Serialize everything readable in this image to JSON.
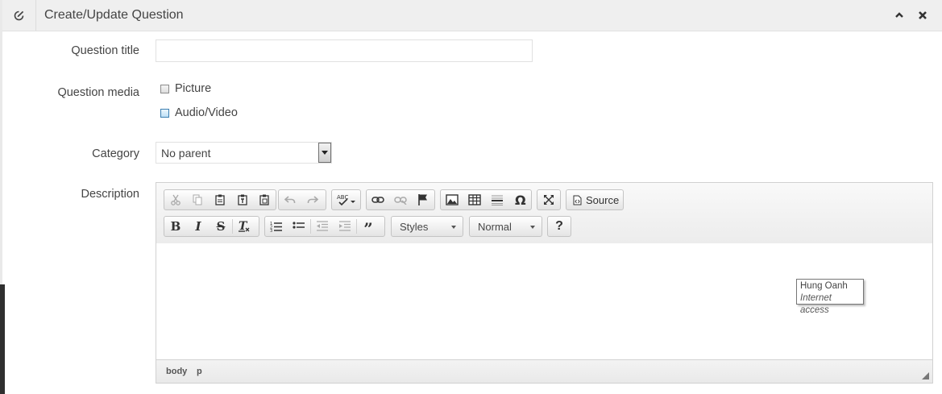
{
  "panel": {
    "title": "Create/Update Question",
    "collapse_icon": "chevron-up-icon",
    "close_icon": "close-icon",
    "edit_icon": "edit-icon"
  },
  "form": {
    "question_title": {
      "label": "Question title",
      "value": ""
    },
    "question_media": {
      "label": "Question media",
      "options": [
        {
          "label": "Picture",
          "checked": false
        },
        {
          "label": "Audio/Video",
          "checked": false
        }
      ]
    },
    "category": {
      "label": "Category",
      "selected": "No parent"
    },
    "description": {
      "label": "Description"
    }
  },
  "editor": {
    "toolbar_row1": {
      "clipboard": [
        "cut-icon",
        "copy-icon",
        "paste-icon",
        "paste-text-icon",
        "paste-word-icon"
      ],
      "history": [
        "undo-icon",
        "redo-icon"
      ],
      "spellcheck": "spellcheck-icon",
      "links": [
        "link-icon",
        "unlink-icon",
        "anchor-icon"
      ],
      "insert": [
        "image-icon",
        "table-icon",
        "horizontal-line-icon",
        "special-char-icon"
      ],
      "maximize": "maximize-icon",
      "source_label": "Source"
    },
    "toolbar_row2": {
      "basic": [
        "bold-icon",
        "italic-icon",
        "strike-icon",
        "remove-format-icon"
      ],
      "lists": [
        "numbered-list-icon",
        "bulleted-list-icon",
        "outdent-icon",
        "indent-icon",
        "blockquote-icon"
      ],
      "styles_label": "Styles",
      "format_label": "Normal",
      "help_label": "?"
    },
    "tooltip": {
      "name": "Hung Oanh",
      "status": "Internet access"
    },
    "path": [
      "body",
      "p"
    ]
  }
}
